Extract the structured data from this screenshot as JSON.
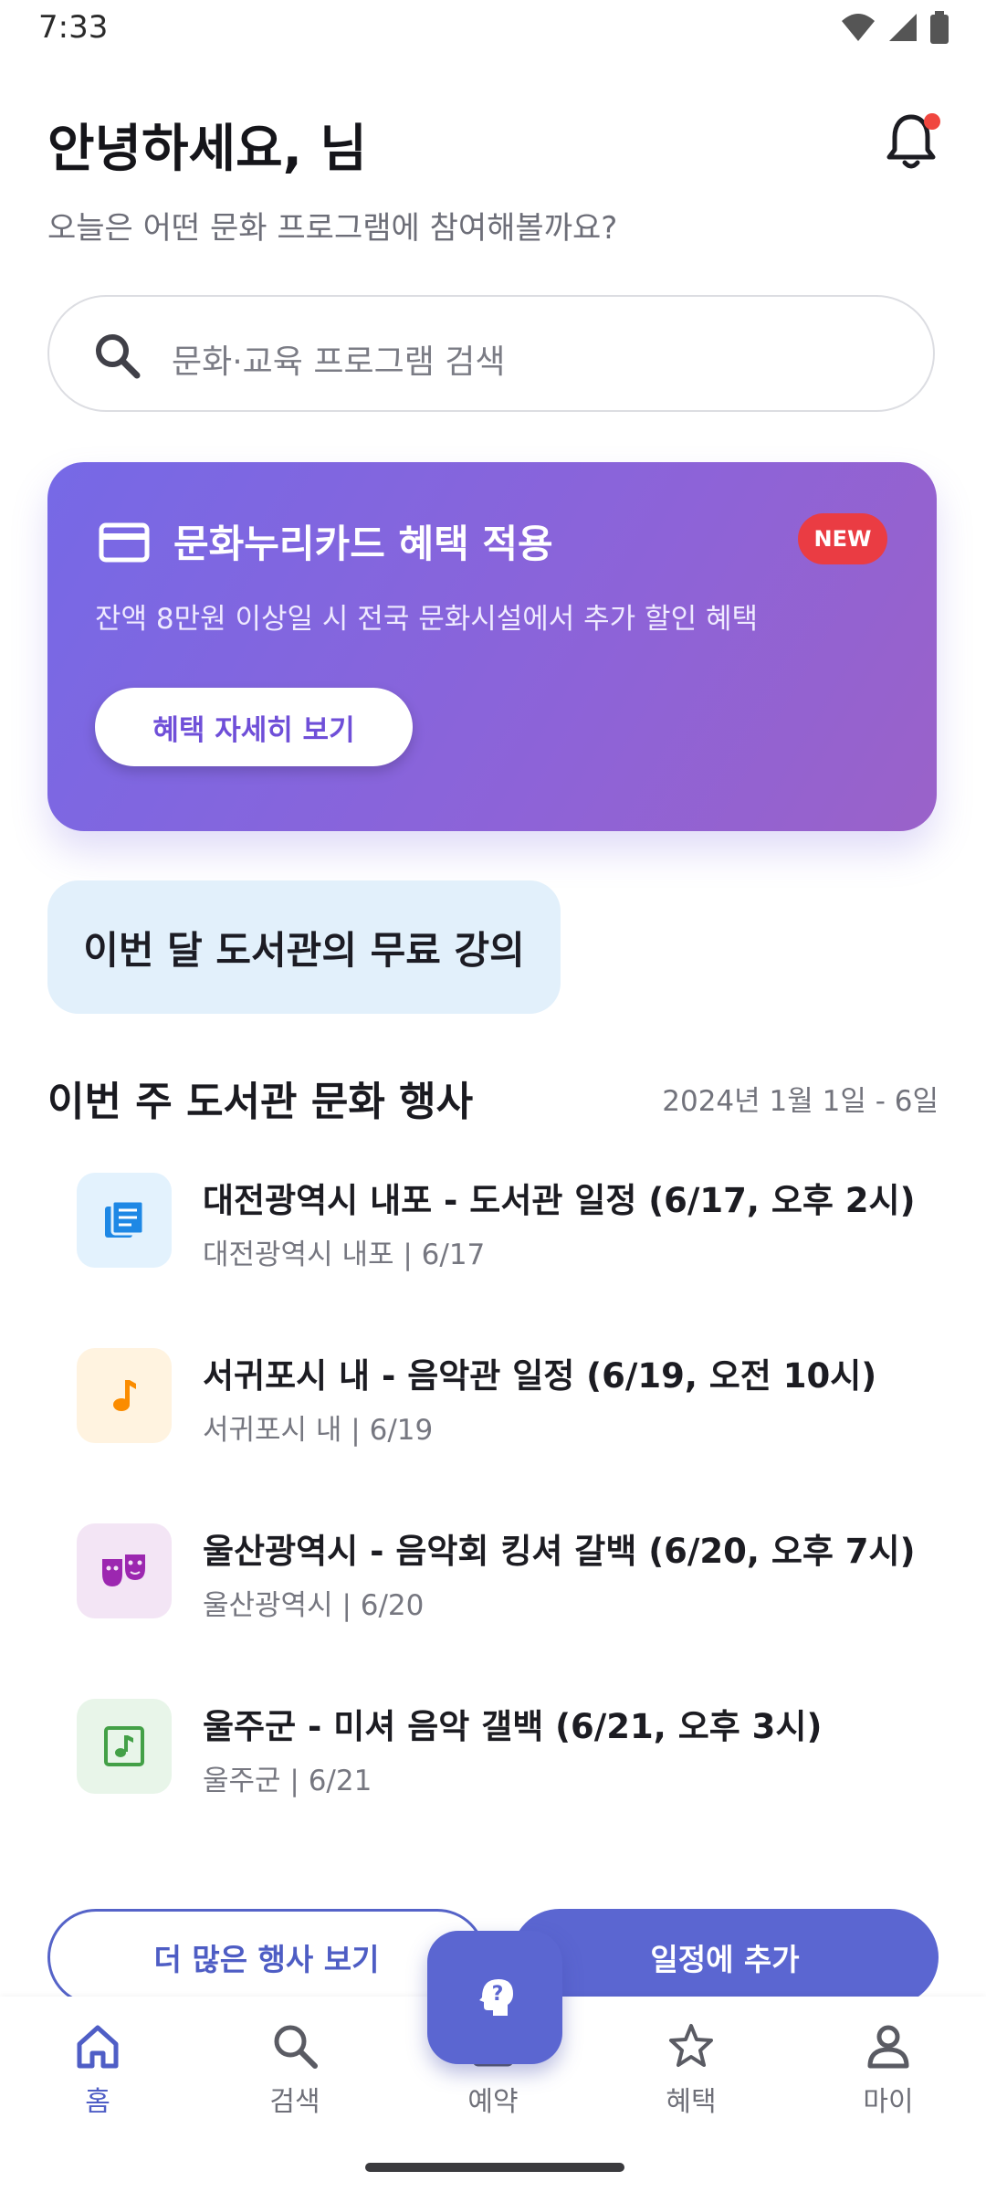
{
  "status_bar": {
    "time": "7:33"
  },
  "header": {
    "greeting": "안녕하세요, 님",
    "subtitle": "오늘은 어떤 문화 프로그램에 참여해볼까요?"
  },
  "search": {
    "placeholder": "문화·교육 프로그램 검색"
  },
  "promo": {
    "title": "문화누리카드 혜택 적용",
    "badge": "NEW",
    "description": "잔액 8만원 이상일 시 전국 문화시설에서 추가 할인 혜택",
    "button_label": "혜택 자세히 보기"
  },
  "chip": {
    "label": "이번 달 도서관의 무료 강의"
  },
  "events_section": {
    "title": "이번 주 도서관 문화 행사",
    "date_range": "2024년 1월 1일 - 6일",
    "items": [
      {
        "title": "대전광역시 내포 - 도서관 일정 (6/17, 오후 2시)",
        "subtitle": "대전광역시 내포 | 6/17",
        "icon": "library-book-icon",
        "icon_bg": "#e3f2fd",
        "icon_color": "#1e88e5"
      },
      {
        "title": "서귀포시 내 - 음악관 일정 (6/19, 오전 10시)",
        "subtitle": "서귀포시 내 | 6/19",
        "icon": "music-note-icon",
        "icon_bg": "#fff3e0",
        "icon_color": "#fb8c00"
      },
      {
        "title": "울산광역시 - 음악회 킹셔 갈백 (6/20, 오후 7시)",
        "subtitle": "울산광역시 | 6/20",
        "icon": "theater-masks-icon",
        "icon_bg": "#f3e5f5",
        "icon_color": "#9c27b0"
      },
      {
        "title": "울주군 - 미셔 음악 갤백 (6/21, 오후 3시)",
        "subtitle": "울주군 | 6/21",
        "icon": "music-box-icon",
        "icon_bg": "#e8f5e9",
        "icon_color": "#43a047"
      }
    ]
  },
  "actions": {
    "more_label": "더 많은 행사 보기",
    "add_label": "일정에 추가"
  },
  "bottom_nav": {
    "items": [
      {
        "label": "홈",
        "icon": "home-icon",
        "active": true
      },
      {
        "label": "검색",
        "icon": "search-icon"
      },
      {
        "label": "예약",
        "icon": "calendar-icon"
      },
      {
        "label": "혜택",
        "icon": "star-icon"
      },
      {
        "label": "마이",
        "icon": "person-icon"
      }
    ]
  },
  "colors": {
    "accent": "#5b66d1",
    "promo_start": "#7669e6",
    "promo_end": "#9a62c9",
    "badge": "#ea3c43",
    "chip_bg": "#e2f0fb"
  }
}
